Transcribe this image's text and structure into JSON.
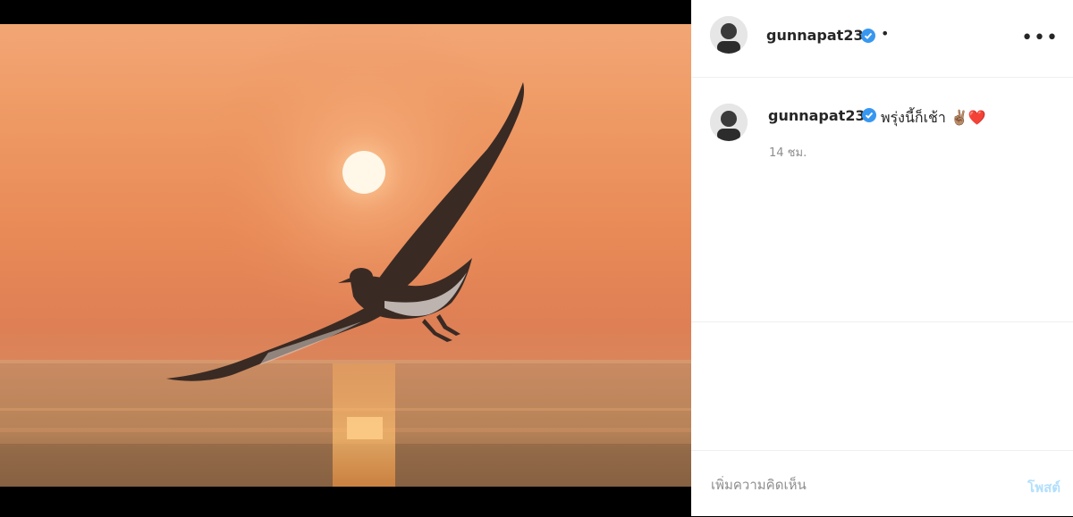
{
  "post": {
    "image_alt": "",
    "image_icon": "seagull-sunset-photo"
  },
  "header": {
    "username": "gunnapat23",
    "verified_icon": "verified-badge-icon",
    "follow_dot": "•",
    "more_label": "•••"
  },
  "caption": {
    "username": "gunnapat23",
    "text": "พรุ่งนี้ก็เช้า ✌🏽❤️",
    "time": "14 ชม."
  },
  "comment": {
    "placeholder": "เพิ่มความคิดเห็น",
    "post_label": "โพสต์"
  },
  "colors": {
    "accent": "#3897f0",
    "post_disabled": "#b2dffc"
  }
}
